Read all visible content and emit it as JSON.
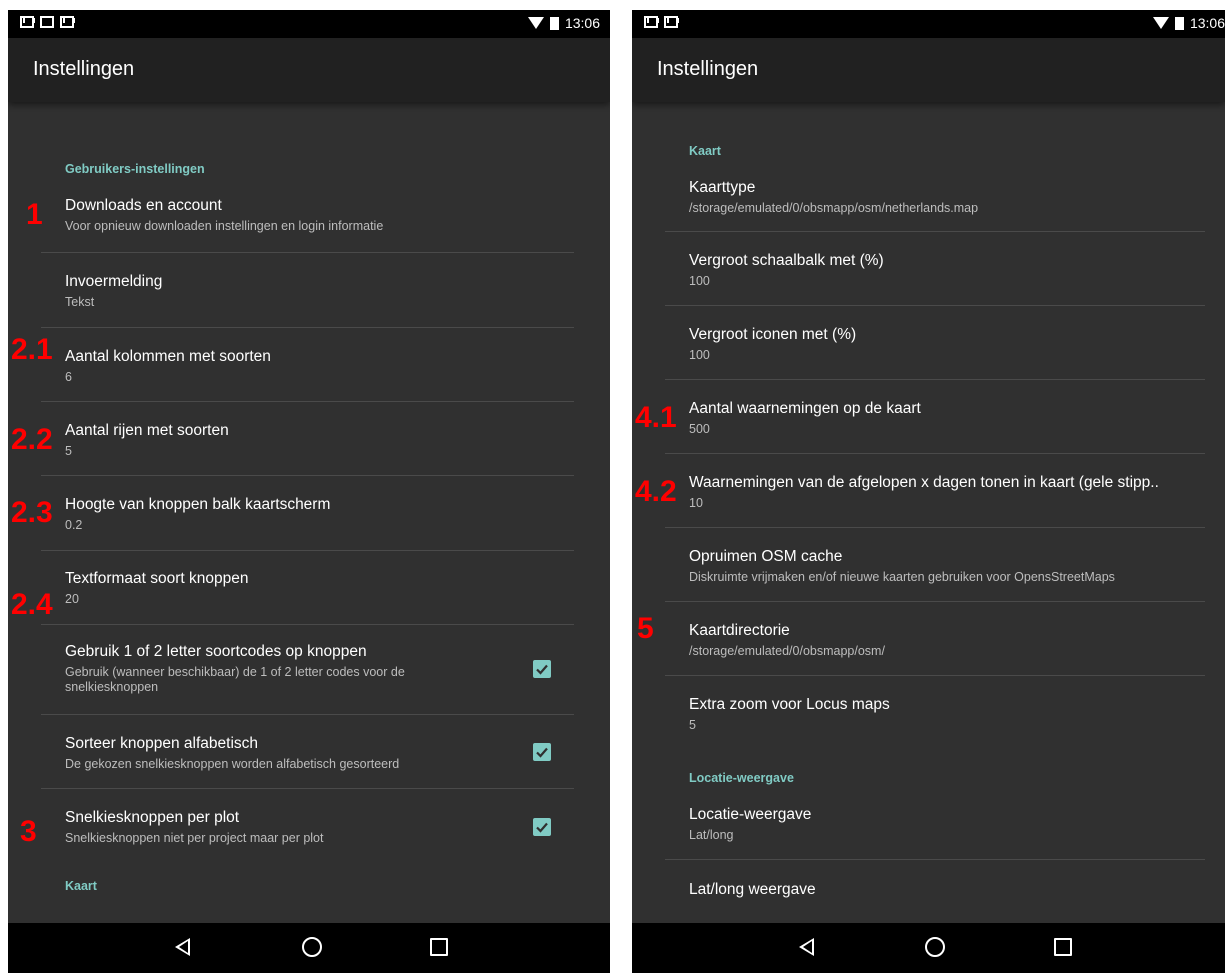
{
  "status": {
    "time": "13:06"
  },
  "left": {
    "toolbar_title": "Instellingen",
    "category_user": "Gebruikers-instellingen",
    "category_map": "Kaart",
    "prefs": [
      {
        "title": "Downloads en account",
        "summary": "Voor opnieuw downloaden instellingen en login informatie"
      },
      {
        "title": "Invoermelding",
        "summary": "Tekst"
      },
      {
        "title": "Aantal kolommen met soorten",
        "summary": "6"
      },
      {
        "title": "Aantal rijen met soorten",
        "summary": "5"
      },
      {
        "title": "Hoogte van knoppen balk kaartscherm",
        "summary": "0.2"
      },
      {
        "title": "Textformaat soort knoppen",
        "summary": "20"
      },
      {
        "title": "Gebruik 1 of 2 letter soortcodes op knoppen",
        "summary": "Gebruik (wanneer beschikbaar) de 1 of 2 letter codes voor de snelkiesknoppen",
        "checked": true
      },
      {
        "title": "Sorteer knoppen alfabetisch",
        "summary": "De gekozen snelkiesknoppen worden alfabetisch gesorteerd",
        "checked": true
      },
      {
        "title": "Snelkiesknoppen per plot",
        "summary": "Snelkiesknoppen niet per project maar per plot",
        "checked": true
      }
    ],
    "annotations": [
      "1",
      "2.1",
      "2.2",
      "2.3",
      "2.4",
      "3"
    ]
  },
  "right": {
    "toolbar_title": "Instellingen",
    "category_map": "Kaart",
    "category_location": "Locatie-weergave",
    "prefs": [
      {
        "title": "Kaarttype",
        "summary": "/storage/emulated/0/obsmapp/osm/netherlands.map"
      },
      {
        "title": "Vergroot schaalbalk met (%)",
        "summary": "100"
      },
      {
        "title": "Vergroot iconen met (%)",
        "summary": "100"
      },
      {
        "title": "Aantal waarnemingen op de kaart",
        "summary": "500"
      },
      {
        "title": "Waarnemingen van de afgelopen x dagen tonen in kaart (gele stipp..",
        "summary": "10"
      },
      {
        "title": "Opruimen OSM cache",
        "summary": "Diskruimte vrijmaken en/of nieuwe kaarten gebruiken voor OpensStreetMaps"
      },
      {
        "title": "Kaartdirectorie",
        "summary": "/storage/emulated/0/obsmapp/osm/"
      },
      {
        "title": "Extra zoom voor Locus maps",
        "summary": "5"
      },
      {
        "title": "Locatie-weergave",
        "summary": "Lat/long"
      },
      {
        "title": "Lat/long weergave",
        "summary": ""
      }
    ],
    "annotations": [
      "4.1",
      "4.2",
      "5"
    ]
  },
  "icons": {
    "status_left": [
      "mail-icon",
      "image-icon",
      "mail-icon"
    ],
    "status_right": [
      "mail-icon",
      "mail-icon"
    ],
    "nav": [
      "back-icon",
      "home-icon",
      "recents-icon"
    ],
    "check": "check-icon"
  },
  "colors": {
    "accent": "#80cbc4",
    "annotation": "#ff0000",
    "background": "#303030",
    "toolbar": "#212121"
  }
}
